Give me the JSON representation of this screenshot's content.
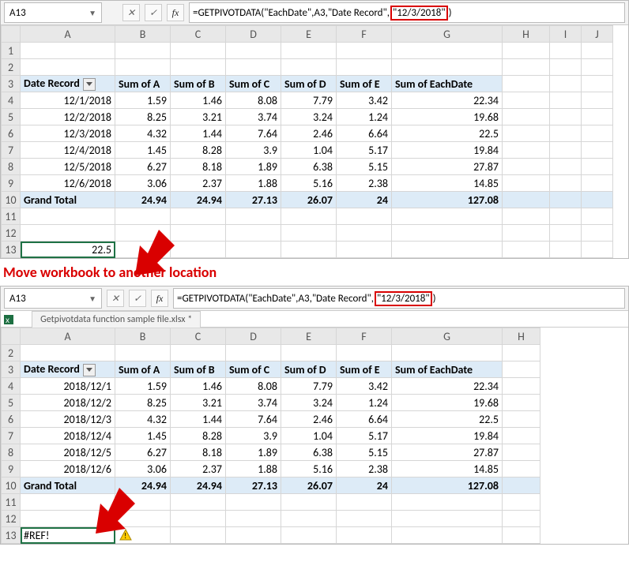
{
  "sheet1": {
    "cellRef": "A13",
    "formula_parts": [
      "=GETPIVOTDATA(\"EachDate\",A3,\"Date Record\"",
      ",",
      "\"12/3/2018\"",
      ")"
    ],
    "cols": [
      "A",
      "B",
      "C",
      "D",
      "E",
      "F",
      "G",
      "H",
      "I",
      "J"
    ],
    "rows": [
      "1",
      "2",
      "3",
      "4",
      "5",
      "6",
      "7",
      "8",
      "9",
      "10",
      "11",
      "12",
      "13"
    ],
    "headers": [
      "Date Record",
      "Sum of A",
      "Sum of B",
      "Sum of C",
      "Sum of D",
      "Sum of E",
      "Sum of EachDate"
    ],
    "data": [
      [
        "12/1/2018",
        "1.59",
        "1.46",
        "8.08",
        "7.79",
        "3.42",
        "22.34"
      ],
      [
        "12/2/2018",
        "8.25",
        "3.21",
        "3.74",
        "3.24",
        "1.24",
        "19.68"
      ],
      [
        "12/3/2018",
        "4.32",
        "1.44",
        "7.64",
        "2.46",
        "6.64",
        "22.5"
      ],
      [
        "12/4/2018",
        "1.45",
        "8.28",
        "3.9",
        "1.04",
        "5.17",
        "19.84"
      ],
      [
        "12/5/2018",
        "6.27",
        "8.18",
        "1.89",
        "6.38",
        "5.15",
        "27.87"
      ],
      [
        "12/6/2018",
        "3.06",
        "2.37",
        "1.88",
        "5.16",
        "2.38",
        "14.85"
      ]
    ],
    "total_label": "Grand Total",
    "totals": [
      "24.94",
      "24.94",
      "27.13",
      "26.07",
      "24",
      "127.08"
    ],
    "result": "22.5"
  },
  "caption": "Move workbook to another location",
  "sheet2": {
    "cellRef": "A13",
    "formula_parts": [
      "=GETPIVOTDATA(\"EachDate\",A3,\"Date Record\",",
      "\"12/3/2018\"",
      ")"
    ],
    "tab": "Getpivotdata function sample file.xlsx *",
    "cols": [
      "A",
      "B",
      "C",
      "D",
      "E",
      "F",
      "G",
      "H"
    ],
    "rows": [
      "2",
      "3",
      "4",
      "5",
      "6",
      "7",
      "8",
      "9",
      "10",
      "11",
      "12",
      "13"
    ],
    "headers": [
      "Date Record",
      "Sum of A",
      "Sum of B",
      "Sum of C",
      "Sum of D",
      "Sum of E",
      "Sum of EachDate"
    ],
    "data": [
      [
        "2018/12/1",
        "1.59",
        "1.46",
        "8.08",
        "7.79",
        "3.42",
        "22.34"
      ],
      [
        "2018/12/2",
        "8.25",
        "3.21",
        "3.74",
        "3.24",
        "1.24",
        "19.68"
      ],
      [
        "2018/12/3",
        "4.32",
        "1.44",
        "7.64",
        "2.46",
        "6.64",
        "22.5"
      ],
      [
        "2018/12/4",
        "1.45",
        "8.28",
        "3.9",
        "1.04",
        "5.17",
        "19.84"
      ],
      [
        "2018/12/5",
        "6.27",
        "8.18",
        "1.89",
        "6.38",
        "5.15",
        "27.87"
      ],
      [
        "2018/12/6",
        "3.06",
        "2.37",
        "1.88",
        "5.16",
        "2.38",
        "14.85"
      ]
    ],
    "total_label": "Grand Total",
    "totals": [
      "24.94",
      "24.94",
      "27.13",
      "26.07",
      "24",
      "127.08"
    ],
    "result": "#REF!"
  },
  "colwidths1": [
    120,
    70,
    70,
    70,
    70,
    70,
    140,
    60,
    40,
    40
  ],
  "colwidths2": [
    120,
    70,
    70,
    70,
    70,
    70,
    140,
    48
  ]
}
